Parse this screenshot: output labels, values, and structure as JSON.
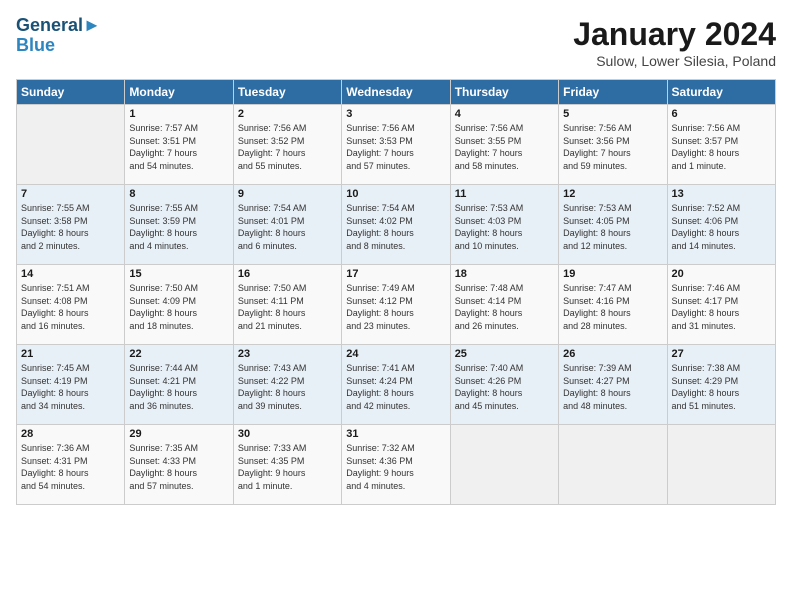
{
  "header": {
    "logo_line1": "General",
    "logo_line2": "Blue",
    "month": "January 2024",
    "location": "Sulow, Lower Silesia, Poland"
  },
  "days_of_week": [
    "Sunday",
    "Monday",
    "Tuesday",
    "Wednesday",
    "Thursday",
    "Friday",
    "Saturday"
  ],
  "weeks": [
    [
      {
        "day": "",
        "info": ""
      },
      {
        "day": "1",
        "info": "Sunrise: 7:57 AM\nSunset: 3:51 PM\nDaylight: 7 hours\nand 54 minutes."
      },
      {
        "day": "2",
        "info": "Sunrise: 7:56 AM\nSunset: 3:52 PM\nDaylight: 7 hours\nand 55 minutes."
      },
      {
        "day": "3",
        "info": "Sunrise: 7:56 AM\nSunset: 3:53 PM\nDaylight: 7 hours\nand 57 minutes."
      },
      {
        "day": "4",
        "info": "Sunrise: 7:56 AM\nSunset: 3:55 PM\nDaylight: 7 hours\nand 58 minutes."
      },
      {
        "day": "5",
        "info": "Sunrise: 7:56 AM\nSunset: 3:56 PM\nDaylight: 7 hours\nand 59 minutes."
      },
      {
        "day": "6",
        "info": "Sunrise: 7:56 AM\nSunset: 3:57 PM\nDaylight: 8 hours\nand 1 minute."
      }
    ],
    [
      {
        "day": "7",
        "info": "Sunrise: 7:55 AM\nSunset: 3:58 PM\nDaylight: 8 hours\nand 2 minutes."
      },
      {
        "day": "8",
        "info": "Sunrise: 7:55 AM\nSunset: 3:59 PM\nDaylight: 8 hours\nand 4 minutes."
      },
      {
        "day": "9",
        "info": "Sunrise: 7:54 AM\nSunset: 4:01 PM\nDaylight: 8 hours\nand 6 minutes."
      },
      {
        "day": "10",
        "info": "Sunrise: 7:54 AM\nSunset: 4:02 PM\nDaylight: 8 hours\nand 8 minutes."
      },
      {
        "day": "11",
        "info": "Sunrise: 7:53 AM\nSunset: 4:03 PM\nDaylight: 8 hours\nand 10 minutes."
      },
      {
        "day": "12",
        "info": "Sunrise: 7:53 AM\nSunset: 4:05 PM\nDaylight: 8 hours\nand 12 minutes."
      },
      {
        "day": "13",
        "info": "Sunrise: 7:52 AM\nSunset: 4:06 PM\nDaylight: 8 hours\nand 14 minutes."
      }
    ],
    [
      {
        "day": "14",
        "info": "Sunrise: 7:51 AM\nSunset: 4:08 PM\nDaylight: 8 hours\nand 16 minutes."
      },
      {
        "day": "15",
        "info": "Sunrise: 7:50 AM\nSunset: 4:09 PM\nDaylight: 8 hours\nand 18 minutes."
      },
      {
        "day": "16",
        "info": "Sunrise: 7:50 AM\nSunset: 4:11 PM\nDaylight: 8 hours\nand 21 minutes."
      },
      {
        "day": "17",
        "info": "Sunrise: 7:49 AM\nSunset: 4:12 PM\nDaylight: 8 hours\nand 23 minutes."
      },
      {
        "day": "18",
        "info": "Sunrise: 7:48 AM\nSunset: 4:14 PM\nDaylight: 8 hours\nand 26 minutes."
      },
      {
        "day": "19",
        "info": "Sunrise: 7:47 AM\nSunset: 4:16 PM\nDaylight: 8 hours\nand 28 minutes."
      },
      {
        "day": "20",
        "info": "Sunrise: 7:46 AM\nSunset: 4:17 PM\nDaylight: 8 hours\nand 31 minutes."
      }
    ],
    [
      {
        "day": "21",
        "info": "Sunrise: 7:45 AM\nSunset: 4:19 PM\nDaylight: 8 hours\nand 34 minutes."
      },
      {
        "day": "22",
        "info": "Sunrise: 7:44 AM\nSunset: 4:21 PM\nDaylight: 8 hours\nand 36 minutes."
      },
      {
        "day": "23",
        "info": "Sunrise: 7:43 AM\nSunset: 4:22 PM\nDaylight: 8 hours\nand 39 minutes."
      },
      {
        "day": "24",
        "info": "Sunrise: 7:41 AM\nSunset: 4:24 PM\nDaylight: 8 hours\nand 42 minutes."
      },
      {
        "day": "25",
        "info": "Sunrise: 7:40 AM\nSunset: 4:26 PM\nDaylight: 8 hours\nand 45 minutes."
      },
      {
        "day": "26",
        "info": "Sunrise: 7:39 AM\nSunset: 4:27 PM\nDaylight: 8 hours\nand 48 minutes."
      },
      {
        "day": "27",
        "info": "Sunrise: 7:38 AM\nSunset: 4:29 PM\nDaylight: 8 hours\nand 51 minutes."
      }
    ],
    [
      {
        "day": "28",
        "info": "Sunrise: 7:36 AM\nSunset: 4:31 PM\nDaylight: 8 hours\nand 54 minutes."
      },
      {
        "day": "29",
        "info": "Sunrise: 7:35 AM\nSunset: 4:33 PM\nDaylight: 8 hours\nand 57 minutes."
      },
      {
        "day": "30",
        "info": "Sunrise: 7:33 AM\nSunset: 4:35 PM\nDaylight: 9 hours\nand 1 minute."
      },
      {
        "day": "31",
        "info": "Sunrise: 7:32 AM\nSunset: 4:36 PM\nDaylight: 9 hours\nand 4 minutes."
      },
      {
        "day": "",
        "info": ""
      },
      {
        "day": "",
        "info": ""
      },
      {
        "day": "",
        "info": ""
      }
    ]
  ]
}
